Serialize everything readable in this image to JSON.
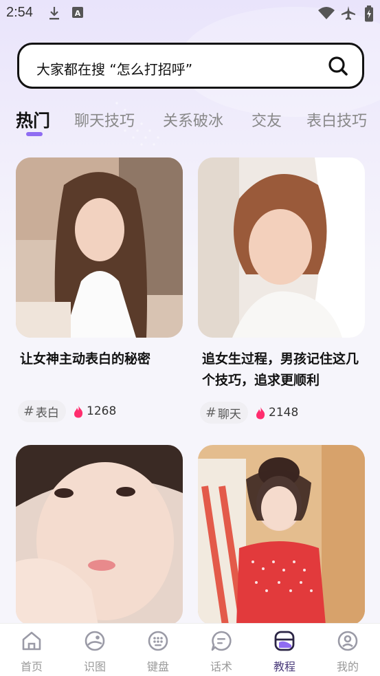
{
  "status_bar": {
    "time": "2:54",
    "left_icons": [
      "download-icon",
      "keyboard-a-icon"
    ],
    "right_icons": [
      "wifi-icon",
      "airplane-icon",
      "battery-icon"
    ]
  },
  "search": {
    "text": "大家都在搜 “怎么打招呼”",
    "icon": "search-icon"
  },
  "tabs": [
    {
      "label": "热门",
      "active": true
    },
    {
      "label": "聊天技巧",
      "active": false
    },
    {
      "label": "关系破冰",
      "active": false
    },
    {
      "label": "交友",
      "active": false
    },
    {
      "label": "表白技巧",
      "active": false
    }
  ],
  "colors": {
    "accent": "#8f6cf2",
    "flame": "#ff2d6e",
    "nav_active": "#4a3b7a",
    "nav_inactive": "#999999"
  },
  "cards": [
    {
      "title": "让女神主动表白的秘密",
      "tag": "表白",
      "likes": "1268",
      "image": "photo-woman-white-top"
    },
    {
      "title": "追女生过程，男孩记住这几个技巧，追求更顺利",
      "tag": "聊天",
      "likes": "2148",
      "image": "photo-woman-bathrobe"
    },
    {
      "title": "",
      "tag": "",
      "likes": "",
      "image": "photo-woman-closeup"
    },
    {
      "title": "",
      "tag": "",
      "likes": "",
      "image": "photo-woman-red-dress"
    }
  ],
  "bottom_nav": [
    {
      "label": "首页",
      "icon": "home-icon",
      "active": false
    },
    {
      "label": "识图",
      "icon": "image-recognition-icon",
      "active": false
    },
    {
      "label": "键盘",
      "icon": "keyboard-icon",
      "active": false
    },
    {
      "label": "话术",
      "icon": "chat-script-icon",
      "active": false
    },
    {
      "label": "教程",
      "icon": "tutorial-icon",
      "active": true
    },
    {
      "label": "我的",
      "icon": "profile-icon",
      "active": false
    }
  ]
}
